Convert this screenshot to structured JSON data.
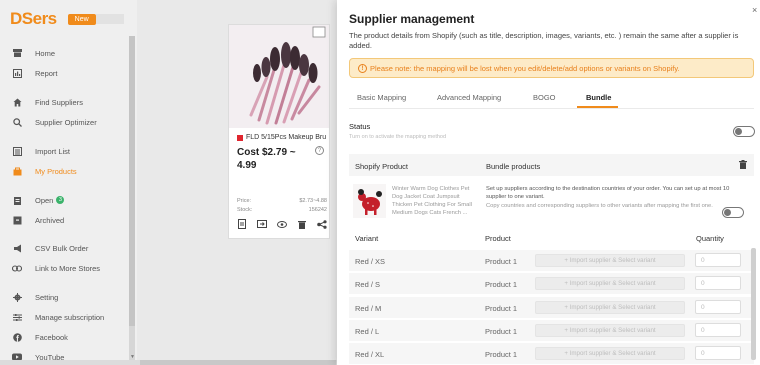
{
  "sidebar": {
    "logo": "DSers",
    "badge": "New",
    "items": [
      {
        "label": "Home",
        "icon": "store-icon",
        "active": false
      },
      {
        "label": "Report",
        "icon": "report-icon",
        "active": false
      },
      {
        "label": "Find Suppliers",
        "icon": "home-icon",
        "active": false
      },
      {
        "label": "Supplier Optimizer",
        "icon": "search-icon",
        "active": false
      },
      {
        "label": "Import List",
        "icon": "list-icon",
        "active": false
      },
      {
        "label": "My Products",
        "icon": "bag-icon",
        "active": true
      },
      {
        "label": "Open",
        "icon": "clipboard-icon",
        "active": false,
        "count": "3"
      },
      {
        "label": "Archived",
        "icon": "archive-icon",
        "active": false
      },
      {
        "label": "CSV Bulk Order",
        "icon": "megaphone-icon",
        "active": false
      },
      {
        "label": "Link to More Stores",
        "icon": "link-icon",
        "active": false
      },
      {
        "label": "Setting",
        "icon": "gear-icon",
        "active": false
      },
      {
        "label": "Manage subscription",
        "icon": "sliders-icon",
        "active": false
      },
      {
        "label": "Facebook",
        "icon": "facebook-icon",
        "active": false
      },
      {
        "label": "YouTube",
        "icon": "youtube-icon",
        "active": false
      }
    ]
  },
  "card": {
    "title": "FLD 5/15Pcs Makeup Bru",
    "cost": "Cost $2.79 ~ 4.99",
    "price_label": "Price:",
    "price_value": "$2.73~4.88",
    "stock_label": "Stock:",
    "stock_value": "156242"
  },
  "drawer": {
    "title": "Supplier management",
    "description": "The product details from Shopify (such as title, description, images, variants, etc. ) remain the same after a supplier is added.",
    "warning": "Please note: the mapping will be lost when you edit/delete/add options or variants on Shopify.",
    "tabs": [
      "Basic Mapping",
      "Advanced Mapping",
      "BOGO",
      "Bundle"
    ],
    "active_tab": "Bundle",
    "status_label": "Status",
    "status_hint": "Turn on to activate the mapping method",
    "table_headers": {
      "shopify": "Shopify Product",
      "bundle": "Bundle products"
    },
    "bundle_product_name": "Winter Warm Dog Clothes Pet Dog Jacket Coat Jumpsuit Thicken Pet Clothing For Small Medium Dogs Cats French ...",
    "bundle_text1": "Set up suppliers according to the destination countries of your order. You can set up at most 10 supplier to one variant.",
    "bundle_text2": "Copy countries and corresponding suppliers to other variants after mapping the first one.",
    "variant_headers": {
      "variant": "Variant",
      "product": "Product",
      "quantity": "Quantity"
    },
    "import_label": "+ Import supplier & Select variant",
    "qty_placeholder": "0",
    "rows": [
      {
        "variant": "Red / XS",
        "product": "Product 1"
      },
      {
        "variant": "Red / S",
        "product": "Product 1"
      },
      {
        "variant": "Red / M",
        "product": "Product 1"
      },
      {
        "variant": "Red / L",
        "product": "Product 1"
      },
      {
        "variant": "Red / XL",
        "product": "Product 1"
      }
    ]
  },
  "colors": {
    "accent": "#f08b1b",
    "warning_bg": "#fdebc8",
    "success": "#3bb36b"
  }
}
